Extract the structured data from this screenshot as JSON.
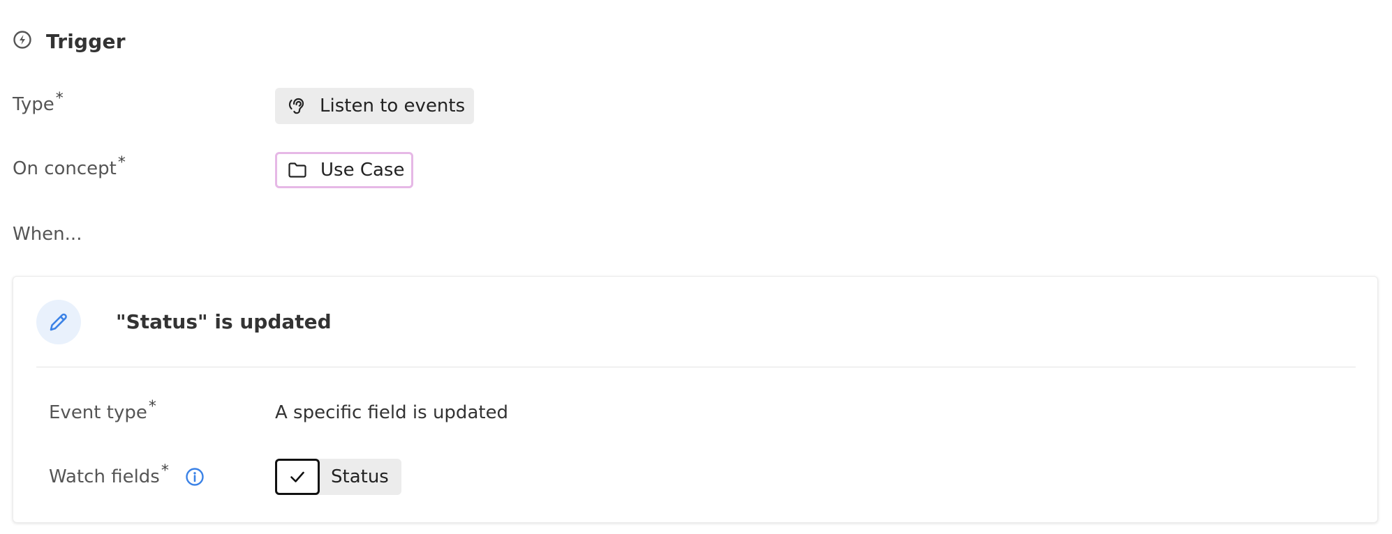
{
  "section": {
    "title": "Trigger",
    "icon": "bolt-circle-icon"
  },
  "fields": {
    "type": {
      "label": "Type",
      "required_mark": "*",
      "value": "Listen to events",
      "icon": "ear-icon"
    },
    "on_concept": {
      "label": "On concept",
      "required_mark": "*",
      "value": "Use Case",
      "icon": "folder-icon",
      "border_color": "#e6b8e6"
    },
    "when": {
      "label": "When..."
    }
  },
  "event_card": {
    "title": "\"Status\" is updated",
    "icon": "pencil-icon",
    "icon_bg": "#e9f1fc",
    "icon_color": "#3b82e6",
    "event_type": {
      "label": "Event type",
      "required_mark": "*",
      "value": "A specific field is updated"
    },
    "watch_fields": {
      "label": "Watch fields",
      "required_mark": "*",
      "info_icon": "info-icon",
      "items": [
        {
          "label": "Status",
          "checked": true
        }
      ]
    }
  }
}
